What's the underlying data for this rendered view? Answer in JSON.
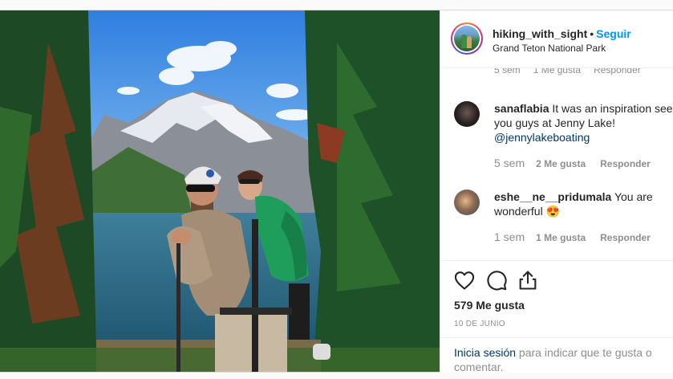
{
  "header": {
    "username": "hiking_with_sight",
    "separator": "•",
    "follow_label": "Seguir",
    "location": "Grand Teton National Park"
  },
  "partial_comment_meta": {
    "age": "5 sem",
    "likes": "1 Me gusta",
    "reply": "Responder"
  },
  "comments": [
    {
      "username": "sanaflabia",
      "text_line1": "It was an inspiration seeing",
      "text_line2": "you guys at Jenny Lake!",
      "mention": "@jennylakeboating",
      "age": "5 sem",
      "likes": "2 Me gusta",
      "reply": "Responder"
    },
    {
      "username": "eshe__ne__pridumala",
      "text_line1": "You are",
      "text_line2": "wonderful",
      "emoji": "😍",
      "age": "1 sem",
      "likes": "1 Me gusta",
      "reply": "Responder"
    }
  ],
  "actions": {
    "like_icon": "heart-icon",
    "comment_icon": "comment-icon",
    "share_icon": "share-icon",
    "likes_count": "579 Me gusta",
    "date": "10 DE JUNIO"
  },
  "login": {
    "link": "Inicia sesión",
    "text": " para indicar que te gusta o comentar."
  },
  "colors": {
    "follow": "#0095f6",
    "link": "#00376b",
    "muted": "#8e8e8e",
    "text": "#262626"
  }
}
